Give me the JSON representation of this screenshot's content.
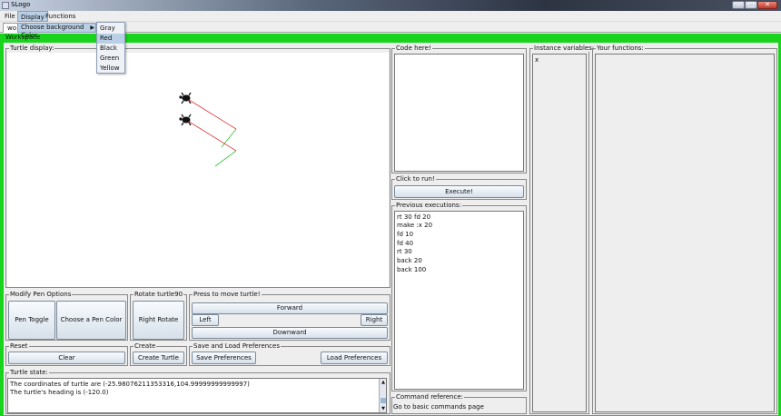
{
  "window": {
    "title": "SLogo"
  },
  "menubar": {
    "items": [
      "File",
      "Display",
      "Functions"
    ]
  },
  "tab": {
    "label": "wo"
  },
  "display_menu": {
    "submenu_label": "Choose background Color",
    "options": [
      "Gray",
      "Red",
      "Black",
      "Green",
      "Yellow"
    ],
    "highlighted": "Red"
  },
  "workspace": {
    "label": "Workspace"
  },
  "turtle_display": {
    "title": "Turtle display:",
    "background": "#ffffff"
  },
  "code_panel": {
    "title": "Code here!"
  },
  "run_panel": {
    "title": "Click to run!",
    "execute_label": "Execute!"
  },
  "history": {
    "title": "Previous executions:",
    "items": [
      "rt 30 fd 20",
      "make :x 20",
      "fd 10",
      "fd 40",
      "rt 30",
      "back 20",
      "back 100"
    ]
  },
  "instance_vars": {
    "title": "Instance variables:",
    "items": [
      "x"
    ]
  },
  "functions": {
    "title": "Your functions:"
  },
  "pen_options": {
    "title": "Modify Pen Options",
    "toggle_label": "Pen Toggle",
    "color_label": "Choose a Pen Color"
  },
  "rotate": {
    "title": "Rotate turtle90",
    "button_label": "Right Rotate"
  },
  "move": {
    "title": "Press to move turtle!",
    "forward": "Forward",
    "left": "Left",
    "right": "Right",
    "down": "Downward"
  },
  "reset": {
    "title": "Reset",
    "button_label": "Clear"
  },
  "create": {
    "title": "Create",
    "button_label": "Create Turtle"
  },
  "prefs": {
    "title": "Save and Load Preferences",
    "save_label": "Save Preferences",
    "load_label": "Load Preferences"
  },
  "turtle_state": {
    "title": "Turtle state:",
    "lines": [
      "The coordinates of turtle are (-25.98076211353316,104.99999999999997)",
      "The turtle's heading is (-120.0)"
    ]
  },
  "command_ref": {
    "title": "Command reference:",
    "link": "Go to basic commands page"
  },
  "colors": {
    "workspace_green": "#18d41d",
    "menu_highlight": "#b8cfe5",
    "pen_red": "#e03030",
    "pen_green": "#30c030"
  }
}
